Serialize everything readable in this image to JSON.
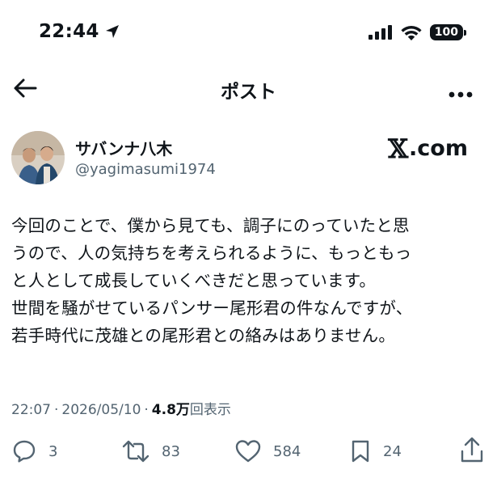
{
  "status_bar": {
    "time": "22:44",
    "battery": "100"
  },
  "header": {
    "title": "ポスト"
  },
  "author": {
    "name": "サバンナ八木",
    "handle": "@yagimasumi1974"
  },
  "brand": {
    "x_glyph": "𝕏",
    "suffix": ".com"
  },
  "post": {
    "lines": [
      "今回のことで、僕から見ても、調子にのっていたと思",
      "うので、人の気持ちを考えられるように、もっともっ",
      "と人として成長していくべきだと思っています。",
      "世間を騒がせているパンサー尾形君の件なんですが、",
      "若手時代に茂雄との尾形君との絡みはありません。"
    ]
  },
  "meta": {
    "time": "22:07",
    "separator": "·",
    "date": "2026/05/10",
    "views_count": "4.8万",
    "views_label": "回表示"
  },
  "actions": {
    "replies": "3",
    "reposts": "83",
    "likes": "584",
    "bookmarks": "24"
  },
  "icons": {
    "location": "location-arrow-icon",
    "signal": "signal-bars-icon",
    "wifi": "wifi-icon",
    "back": "arrow-left-icon",
    "more": "ellipsis-icon",
    "reply": "speech-bubble-icon",
    "repost": "repost-arrows-icon",
    "like": "heart-icon",
    "bookmark": "bookmark-icon",
    "share": "share-upload-icon"
  },
  "colors": {
    "text": "#0f1419",
    "secondary": "#536471",
    "background": "#ffffff"
  }
}
